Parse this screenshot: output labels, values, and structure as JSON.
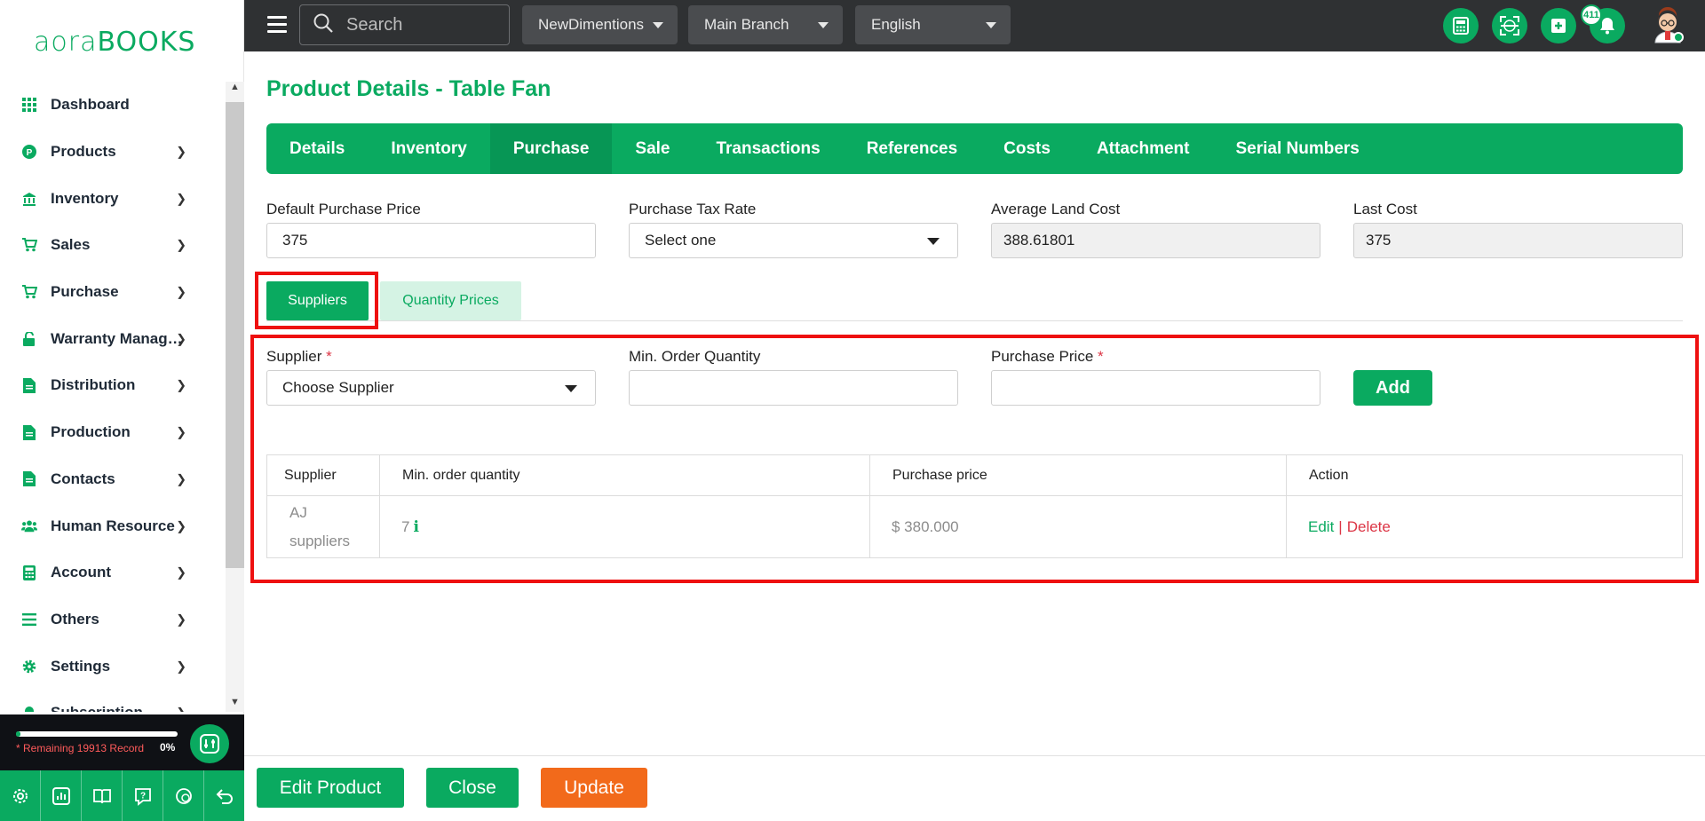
{
  "brand": {
    "logo_light": "aora",
    "logo_bold": "BOOKS"
  },
  "topbar": {
    "search_placeholder": "Search",
    "company": "NewDimentions",
    "branch": "Main Branch",
    "language": "English",
    "notification_count": "411",
    "icons": [
      "calculator-icon",
      "scan-icon",
      "add-icon",
      "bell-icon",
      "user-avatar"
    ]
  },
  "sidebar": {
    "items": [
      {
        "label": "Dashboard",
        "icon": "grid-icon",
        "has_children": false
      },
      {
        "label": "Products",
        "icon": "product-icon",
        "has_children": true
      },
      {
        "label": "Inventory",
        "icon": "warehouse-icon",
        "has_children": true
      },
      {
        "label": "Sales",
        "icon": "cart-icon",
        "has_children": true
      },
      {
        "label": "Purchase",
        "icon": "cart-icon",
        "has_children": true
      },
      {
        "label": "Warranty Manage...",
        "icon": "lock-icon",
        "has_children": true
      },
      {
        "label": "Distribution",
        "icon": "document-icon",
        "has_children": true
      },
      {
        "label": "Production",
        "icon": "document-icon",
        "has_children": true
      },
      {
        "label": "Contacts",
        "icon": "document-icon",
        "has_children": true
      },
      {
        "label": "Human Resource",
        "icon": "users-icon",
        "has_children": true
      },
      {
        "label": "Account",
        "icon": "calculator-icon",
        "has_children": true
      },
      {
        "label": "Others",
        "icon": "list-icon",
        "has_children": true
      },
      {
        "label": "Settings",
        "icon": "gear-icon",
        "has_children": true
      },
      {
        "label": "Subscription",
        "icon": "bell-icon",
        "has_children": true
      }
    ],
    "record_text": "* Remaining 19913 Record",
    "record_percent": "0%",
    "record_progress_fraction": 0.03,
    "bottom_tools": [
      "settings-icon",
      "chart-icon",
      "book-icon",
      "help-icon",
      "chat-icon",
      "back-icon"
    ]
  },
  "page": {
    "title": "Product Details - Table Fan",
    "tabs": [
      "Details",
      "Inventory",
      "Purchase",
      "Sale",
      "Transactions",
      "References",
      "Costs",
      "Attachment",
      "Serial Numbers"
    ],
    "active_tab": "Purchase",
    "fields": {
      "default_purchase_price_label": "Default Purchase Price",
      "default_purchase_price": "375",
      "purchase_tax_rate_label": "Purchase Tax Rate",
      "purchase_tax_rate": "Select one",
      "average_land_cost_label": "Average Land Cost",
      "average_land_cost": "388.61801",
      "last_cost_label": "Last Cost",
      "last_cost": "375"
    },
    "subtabs": {
      "suppliers": "Suppliers",
      "quantity_prices": "Quantity Prices"
    },
    "supplier_form": {
      "supplier_label": "Supplier",
      "supplier_placeholder": "Choose Supplier",
      "min_order_label": "Min. Order Quantity",
      "purchase_price_label": "Purchase Price",
      "required_mark": "*",
      "add_label": "Add"
    },
    "table": {
      "headers": [
        "Supplier",
        "Min. order quantity",
        "Purchase price",
        "Action"
      ],
      "rows": [
        {
          "supplier": "AJ suppliers",
          "min_qty": "7",
          "price": "$ 380.000",
          "edit": "Edit",
          "sep": "|",
          "delete": "Delete"
        }
      ]
    }
  },
  "footer": {
    "edit_product": "Edit Product",
    "close": "Close",
    "update": "Update"
  },
  "colors": {
    "primary": "#0aaa60",
    "danger": "#dc3545",
    "orange": "#f26a1b",
    "topbar": "#2f3133",
    "highlight": "#ee1010"
  }
}
